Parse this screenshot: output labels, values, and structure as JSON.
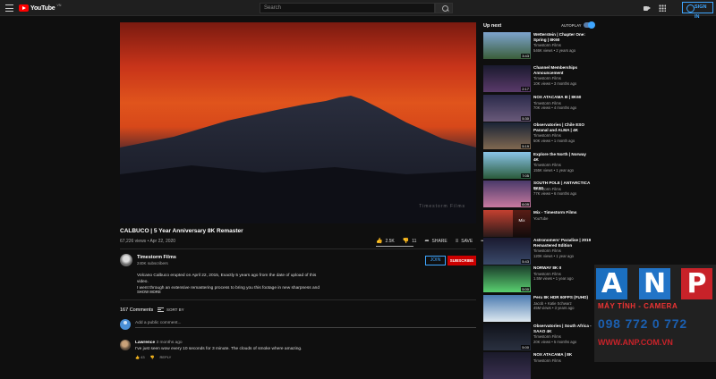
{
  "header": {
    "logo_text": "YouTube",
    "logo_country": "VN",
    "search_placeholder": "Search",
    "signin_label": "SIGN IN"
  },
  "video": {
    "title": "CALBUCO | 5 Year Anniversary 8K Remaster",
    "meta": "67,226 views • Apr 22, 2020",
    "likes": "2.5K",
    "dislikes": "11",
    "like_ratio": 0.99,
    "share_label": "SHARE",
    "save_label": "SAVE",
    "more_label": "•••",
    "watermark": "Timestorm Films"
  },
  "channel": {
    "name": "Timestorm Films",
    "subscribers": "240K subscribers",
    "join_label": "JOIN",
    "subscribe_label": "SUBSCRIBE",
    "description": [
      "Volcano Calbuco erupted on April 22, 2015, Exactly 5 years ago from the date of upload of this",
      "video.",
      "I went through an extensive remastering process to bring you this footage in new sharpness and"
    ],
    "show_more": "SHOW MORE"
  },
  "comments": {
    "count": "167 Comments",
    "sort_label": "SORT BY",
    "add_placeholder": "Add a public comment...",
    "items": [
      {
        "author": "Lawrence",
        "time": "3 months ago",
        "text": "I've just seen wow every 10 seconds for 3 minute. The clouds of smoke where amazing.",
        "likes": "43",
        "reply_label": "REPLY"
      }
    ]
  },
  "sidebar": {
    "up_next": "Up next",
    "autoplay": "AUTOPLAY",
    "items": [
      {
        "title": "Wetterstein | Chapter One: Spring | 8K60",
        "channel": "Timestorm Films",
        "meta": "546K views • 2 years ago",
        "duration": "3:43",
        "colors": [
          "#7da4cf",
          "#3b5e3a"
        ]
      },
      {
        "title": "Channel Memberships Announcement",
        "channel": "Timestorm Films",
        "meta": "10K views • 3 months ago",
        "duration": "2:17",
        "colors": [
          "#1a1a2e",
          "#5a3a6a"
        ]
      },
      {
        "title": "NOX ATACAMA III | 8K60",
        "channel": "Timestorm Films",
        "meta": "70K views • 4 months ago",
        "duration": "5:30",
        "colors": [
          "#2a2a4a",
          "#6a5a7a"
        ]
      },
      {
        "title": "Observatories | Chile ESO Paranal and ALMA | 4K",
        "channel": "Timestorm Films",
        "meta": "50K views • 1 month ago",
        "duration": "5:19",
        "colors": [
          "#1a2436",
          "#806850"
        ]
      },
      {
        "title": "Explore the North | Norway 4K",
        "channel": "Timestorm Films",
        "meta": "155K views • 1 year ago",
        "duration": "7:05",
        "colors": [
          "#8ac4e8",
          "#2a5a3a"
        ]
      },
      {
        "title": "SOUTH POLE | ANTARCTICA 8K60",
        "channel": "Timestorm Films",
        "meta": "77K views • 6 months ago",
        "duration": "6:09",
        "colors": [
          "#4a3a6a",
          "#c87aa0"
        ]
      },
      {
        "title": "Mix - Timestorm Films",
        "channel": "YouTube",
        "meta": "",
        "duration": "",
        "mix_label": "Mix",
        "colors": [
          "#c44030",
          "#2a1a1a"
        ]
      },
      {
        "title": "Astronomers' Paradise | 2019 Remastered Edition",
        "channel": "Timestorm Films",
        "meta": "120K views • 1 year ago",
        "duration": "5:43",
        "colors": [
          "#1a1a30",
          "#3a4a6a"
        ]
      },
      {
        "title": "NORWAY 8K II",
        "channel": "Timestorm Films",
        "meta": "1.5M views • 1 year ago",
        "duration": "5:00",
        "colors": [
          "#1a3a2a",
          "#5ad070"
        ]
      },
      {
        "title": "Peru 8K HDR 60FPS (FUHD)",
        "channel": "Jacob + Katie Schwarz",
        "meta": "45M views • 3 years ago",
        "duration": "",
        "colors": [
          "#4a7ab0",
          "#dde8f0"
        ]
      },
      {
        "title": "Observatories | South Africa - SAAO 4K",
        "channel": "Timestorm Films",
        "meta": "20K views • 5 months ago",
        "duration": "5:00",
        "colors": [
          "#10121a",
          "#2a3040"
        ]
      },
      {
        "title": "NOX ATACAMA | 8K",
        "channel": "Timestorm Films",
        "meta": "",
        "duration": "",
        "colors": [
          "#1a1a2a",
          "#3a3050"
        ]
      }
    ]
  },
  "watermark_ad": {
    "letters": [
      "A",
      "N",
      "P"
    ],
    "tagline": "MÁY TÍNH - CAMERA",
    "phone": "098 772 0 772",
    "url": "WWW.ANP.COM.VN",
    "colors": {
      "blue": "#1b6fc0",
      "red": "#c82229"
    }
  }
}
